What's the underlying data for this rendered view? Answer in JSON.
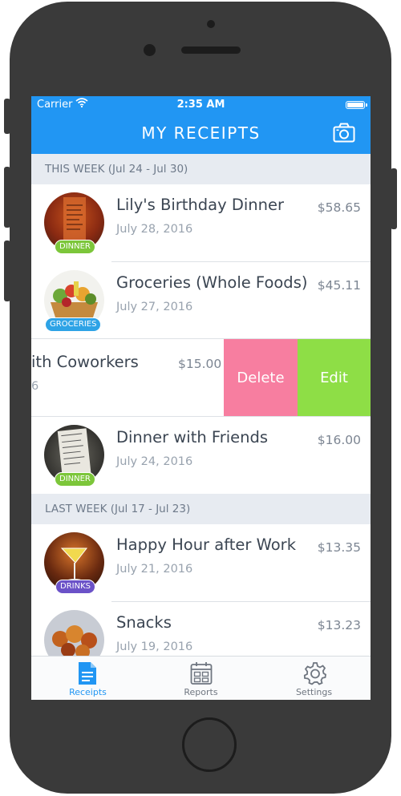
{
  "status_bar": {
    "carrier": "Carrier",
    "time": "2:35 AM"
  },
  "header": {
    "title": "MY RECEIPTS",
    "action_icon": "camera-icon"
  },
  "sections": [
    {
      "label": "THIS WEEK (Jul 24 - Jul 30)",
      "items": [
        {
          "name": "Lily's Birthday Dinner",
          "date": "July 28, 2016",
          "amount": "$58.65",
          "tag": "DINNER"
        },
        {
          "name": "Groceries (Whole Foods)",
          "date": "July 27, 2016",
          "amount": "$45.11",
          "tag": "GROCERIES"
        },
        {
          "name": "ith Coworkers",
          "date": "6",
          "amount": "$15.00",
          "tag": ""
        },
        {
          "name": "Dinner with Friends",
          "date": "July 24, 2016",
          "amount": "$16.00",
          "tag": "DINNER"
        }
      ]
    },
    {
      "label": "LAST WEEK (Jul 17 - Jul 23)",
      "items": [
        {
          "name": "Happy Hour after Work",
          "date": "July 21, 2016",
          "amount": "$13.35",
          "tag": "DRINKS"
        },
        {
          "name": "Snacks",
          "date": "July 19, 2016",
          "amount": "$13.23",
          "tag": ""
        }
      ]
    }
  ],
  "swipe_actions": {
    "delete_label": "Delete",
    "edit_label": "Edit"
  },
  "tab_bar": {
    "tabs": [
      {
        "label": "Receipts",
        "icon": "document-icon",
        "active": true
      },
      {
        "label": "Reports",
        "icon": "calendar-icon",
        "active": false
      },
      {
        "label": "Settings",
        "icon": "gear-icon",
        "active": false
      }
    ]
  },
  "colors": {
    "accent": "#2196f3",
    "delete": "#f77ea0",
    "edit": "#8ede46",
    "tag_dinner": "#7cc63a",
    "tag_groceries": "#2ea3e6",
    "tag_drinks": "#6b52c8",
    "phone_body": "#3a3a3a"
  }
}
